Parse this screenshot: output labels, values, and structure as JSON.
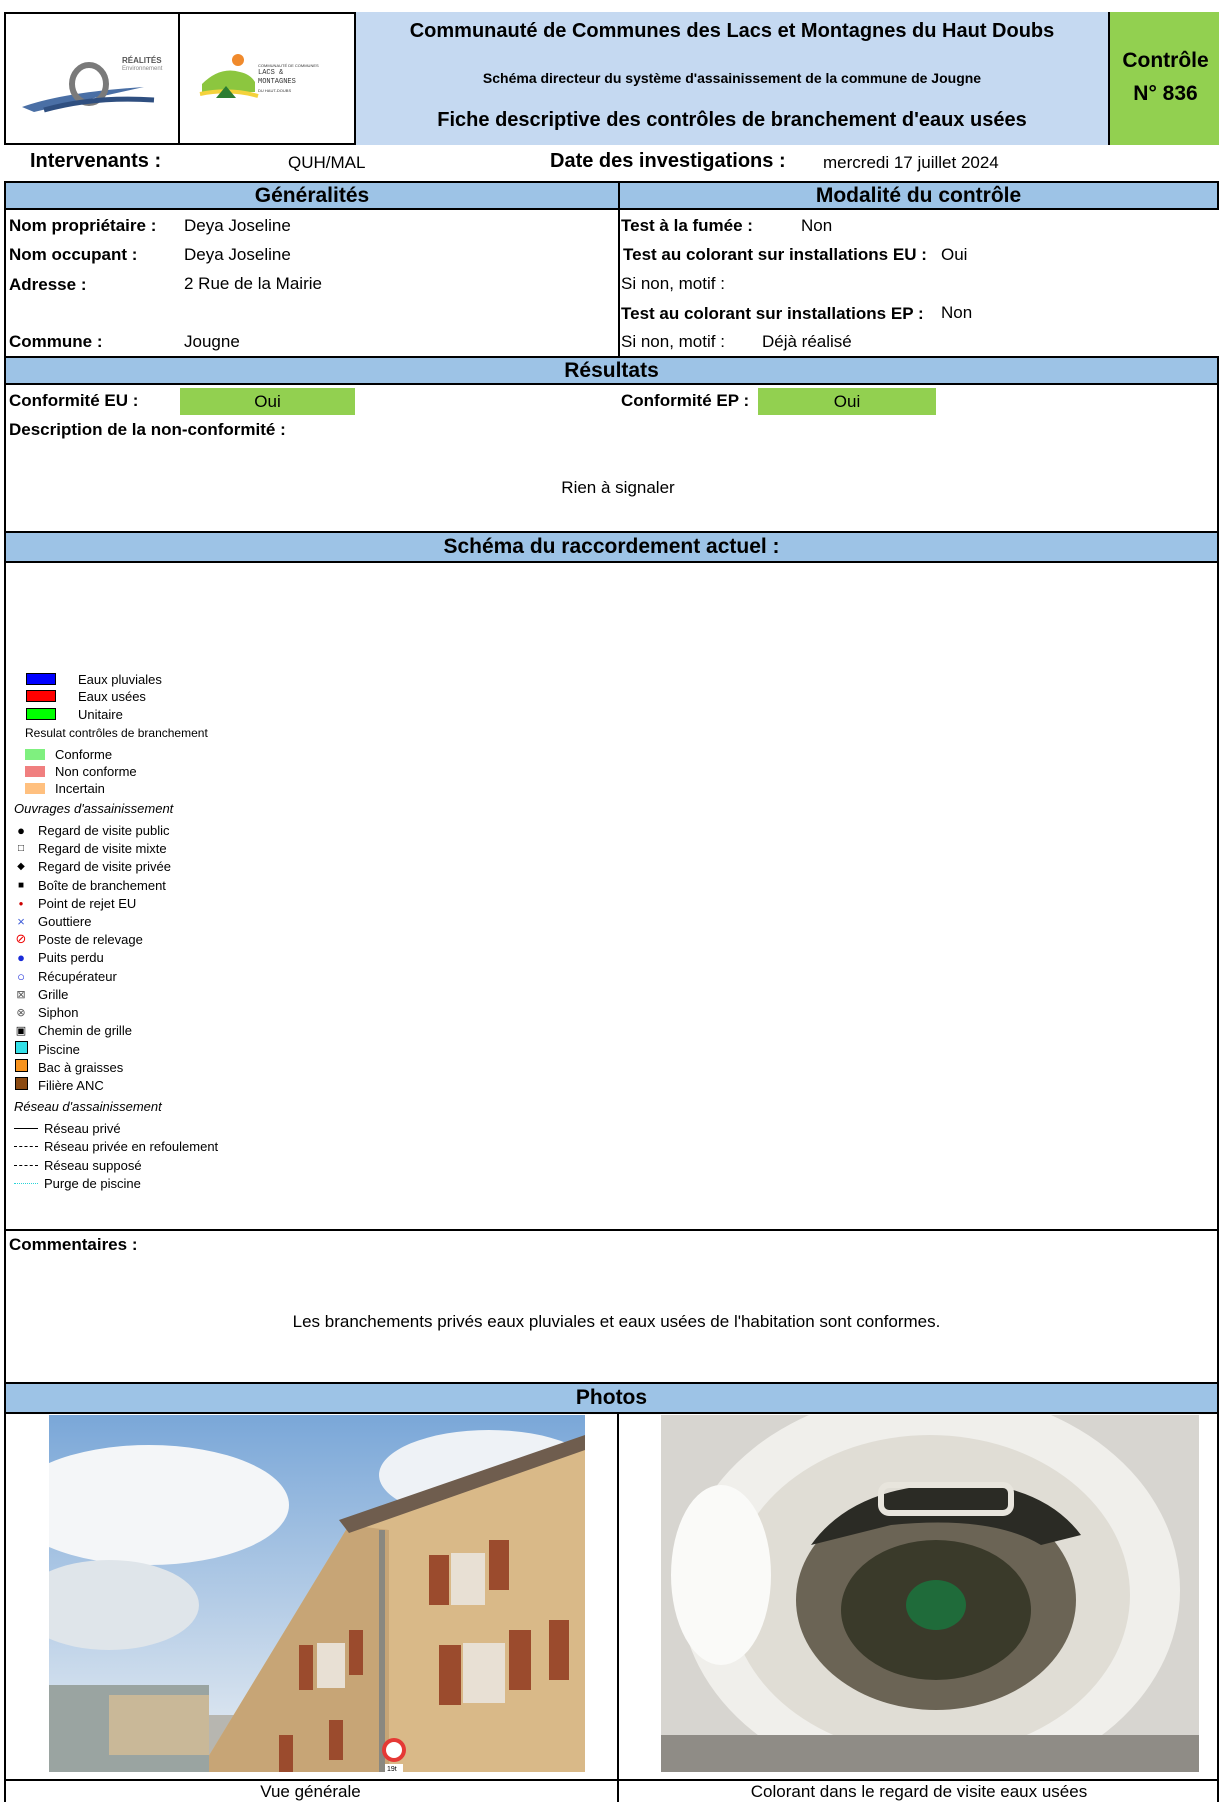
{
  "header": {
    "logo1_text": "RÉALITÉS",
    "logo1_sub": "Environnement",
    "logo2_line1": "COMMUNAUTÉ DE COMMUNES",
    "logo2_line2": "LACS &",
    "logo2_line3": "MONTAGNES",
    "logo2_line4": "DU HAUT-DOUBS",
    "org": "Communauté de Communes des Lacs et Montagnes du Haut Doubs",
    "subtitle": "Schéma directeur du système d'assainissement de la commune de Jougne",
    "form_title": "Fiche descriptive des contrôles de branchement d'eaux usées",
    "control_label": "Contrôle",
    "control_number": "N° 836"
  },
  "meta": {
    "intervenants_label": "Intervenants :",
    "intervenants_value": "QUH/MAL",
    "date_label": "Date des investigations :",
    "date_value": "mercredi 17 juillet 2024"
  },
  "general": {
    "title": "Généralités",
    "owner_label": "Nom propriétaire :",
    "owner_value": "Deya Joseline",
    "occupant_label": "Nom occupant :",
    "occupant_value": "Deya Joseline",
    "address_label": "Adresse :",
    "address_value": "2 Rue de la Mairie",
    "commune_label": "Commune :",
    "commune_value": "Jougne"
  },
  "modality": {
    "title": "Modalité du contrôle",
    "smoke_label": "Test à la fumée :",
    "smoke_value": "Non",
    "dye_eu_label": "Test au colorant sur installations EU :",
    "dye_eu_value": "Oui",
    "reason1_label": "Si non, motif :",
    "dye_ep_label": "Test au colorant sur installations EP :",
    "dye_ep_value": "Non",
    "reason2_label": "Si non, motif :",
    "reason2_value": "Déjà réalisé"
  },
  "results": {
    "title": "Résultats",
    "eu_label": "Conformité EU :",
    "eu_value": "Oui",
    "ep_label": "Conformité EP :",
    "ep_value": "Oui",
    "desc_label": "Description de la non-conformité :",
    "desc_value": "Rien à signaler"
  },
  "schema": {
    "title": "Schéma du raccordement actuel :",
    "legend": {
      "network_types": [
        {
          "label": "Eaux pluviales",
          "color": "#0000ff"
        },
        {
          "label": "Eaux usées",
          "color": "#ff0000"
        },
        {
          "label": "Unitaire",
          "color": "#00ff00"
        }
      ],
      "results_title": "Resulat contrôles de branchement",
      "results": [
        {
          "label": "Conforme",
          "color": "#7ff07f"
        },
        {
          "label": "Non conforme",
          "color": "#f07f7f"
        },
        {
          "label": "Incertain",
          "color": "#ffc07f"
        }
      ],
      "works_title": "Ouvrages d'assainissement",
      "works": [
        {
          "label": "Regard de visite public",
          "icon": "filled-dot"
        },
        {
          "label": "Regard de visite mixte",
          "icon": "hollow-square"
        },
        {
          "label": "Regard de visite privée",
          "icon": "diamond"
        },
        {
          "label": "Boîte de branchement",
          "icon": "filled-square"
        },
        {
          "label": "Point de rejet EU",
          "icon": "small-red-dot"
        },
        {
          "label": "Gouttiere",
          "icon": "blue-cross"
        },
        {
          "label": "Poste de relevage",
          "icon": "red-prohibited"
        },
        {
          "label": "Puits perdu",
          "icon": "blue-dot"
        },
        {
          "label": "Récupérateur",
          "icon": "blue-circle"
        },
        {
          "label": "Grille",
          "icon": "grid-square"
        },
        {
          "label": "Siphon",
          "icon": "target-circle"
        },
        {
          "label": "Chemin de grille",
          "icon": "dotted-square"
        },
        {
          "label": "Piscine",
          "icon": "cyan-square"
        },
        {
          "label": "Bac à graisses",
          "icon": "orange-square"
        },
        {
          "label": "Filière ANC",
          "icon": "brown-square"
        }
      ],
      "network_title": "Réseau d'assainissement",
      "network": [
        {
          "label": "Réseau privé",
          "icon": "solid-line"
        },
        {
          "label": "Réseau privée en refoulement",
          "icon": "dash-dot-line"
        },
        {
          "label": "Réseau supposé",
          "icon": "dashed-line"
        },
        {
          "label": "Purge de piscine",
          "icon": "cyan-dotted-line"
        }
      ]
    }
  },
  "comments": {
    "label": "Commentaires :",
    "text": "Les branchements privés eaux pluviales et eaux usées de l'habitation sont conformes."
  },
  "photos": {
    "title": "Photos",
    "left_caption": "Vue générale",
    "right_caption": "Colorant dans le regard de visite eaux usées",
    "sign_number": "19t"
  }
}
